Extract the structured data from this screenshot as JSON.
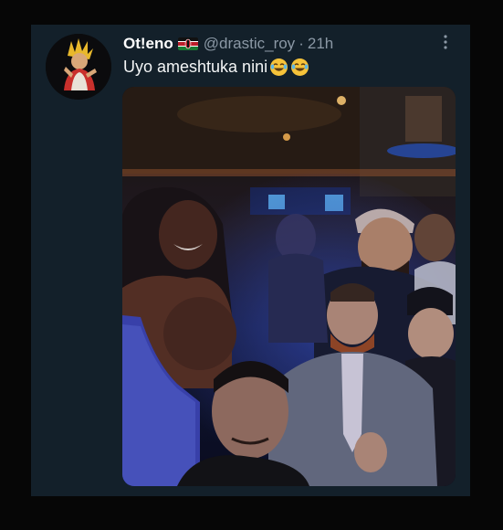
{
  "tweet": {
    "display_name": "Ot!eno",
    "handle": "@drastic_roy",
    "separator": "·",
    "time": "21h",
    "text": "Uyo ameshtuka nini",
    "emoji": [
      "face-with-tears-of-joy",
      "face-with-tears-of-joy"
    ]
  },
  "icons": {
    "flag": "kenya-flag-icon",
    "more": "more-vertical-icon"
  },
  "colors": {
    "background": "#060606",
    "card": "#13202a",
    "name": "#ffffff",
    "secondary_text": "#8b98a5"
  }
}
